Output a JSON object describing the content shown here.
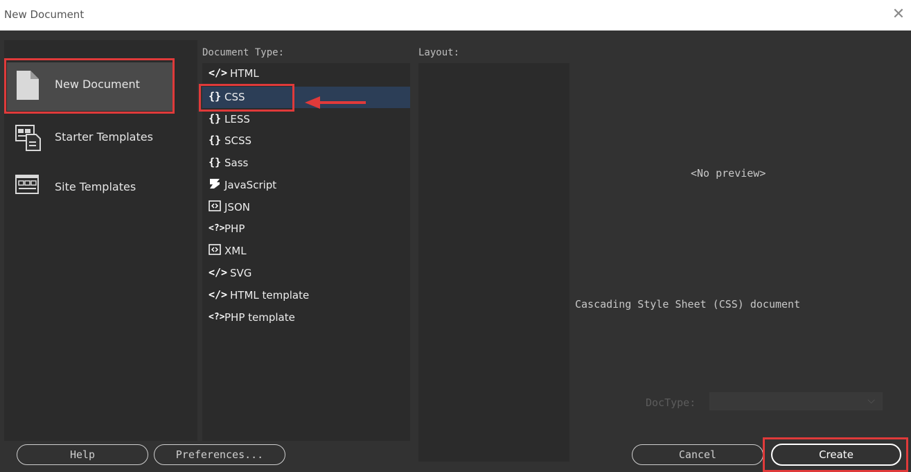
{
  "window": {
    "title": "New Document",
    "close_icon": "close-icon"
  },
  "left_panel": {
    "items": [
      {
        "label": "New Document",
        "icon": "blank-document-icon",
        "selected": true
      },
      {
        "label": "Starter Templates",
        "icon": "starter-templates-icon",
        "selected": false
      },
      {
        "label": "Site Templates",
        "icon": "site-templates-icon",
        "selected": false
      }
    ]
  },
  "document_type": {
    "label": "Document Type:",
    "selected": "CSS",
    "items": [
      {
        "icon_text": "</>",
        "label": "HTML"
      },
      {
        "icon_text": "{}",
        "label": "CSS"
      },
      {
        "icon_text": "{}",
        "label": "LESS"
      },
      {
        "icon_text": "{}",
        "label": "SCSS"
      },
      {
        "icon_text": "{}",
        "label": "Sass"
      },
      {
        "icon_text": "",
        "label": "JavaScript"
      },
      {
        "icon_text": "",
        "label": "JSON"
      },
      {
        "icon_text": "<?>",
        "label": "PHP"
      },
      {
        "icon_text": "",
        "label": "XML"
      },
      {
        "icon_text": "</>",
        "label": "SVG"
      },
      {
        "icon_text": "</>",
        "label": "HTML template"
      },
      {
        "icon_text": "<?>",
        "label": "PHP template"
      }
    ]
  },
  "layout": {
    "label": "Layout:"
  },
  "preview": {
    "placeholder": "<No preview>",
    "description": "Cascading Style Sheet (CSS) document"
  },
  "doctype": {
    "label": "DocType:",
    "value": ""
  },
  "buttons": {
    "help": "Help",
    "preferences": "Preferences...",
    "cancel": "Cancel",
    "create": "Create"
  },
  "colors": {
    "dialog_bg": "#323232",
    "panel_bg": "#2b2b2b",
    "selection_bg": "#2c3e57",
    "highlight": "#e03a3a"
  }
}
